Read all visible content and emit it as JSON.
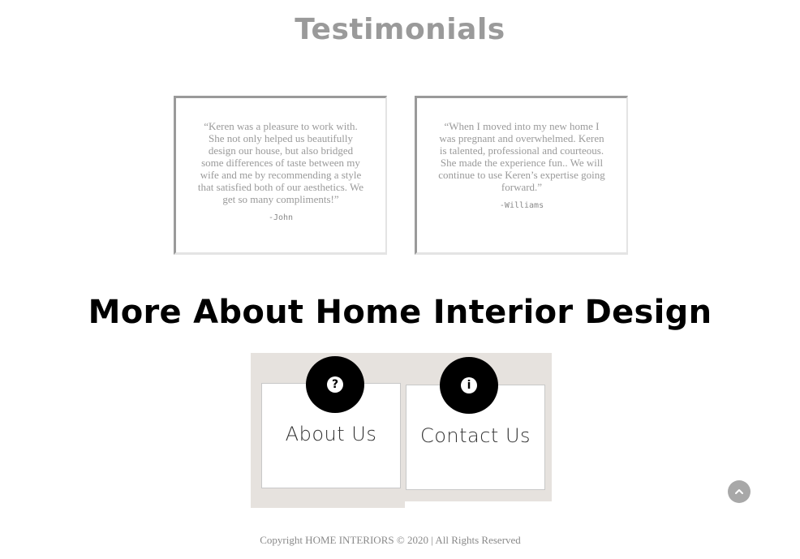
{
  "testimonials": {
    "title": "Testimonials",
    "items": [
      {
        "quote": "“Keren was a pleasure to work with. She not only helped us beautifully design our house, but also bridged some differences of taste between my wife and me by recommending a style that satisfied both of our aesthetics. We get so many compliments!”",
        "author": "-John"
      },
      {
        "quote": "“When I moved into my new home I was pregnant and overwhelmed. Keren is talented, professional and courteous. She made the experience fun.. We will continue to use Keren’s expertise going forward.”",
        "author": "-Williams"
      }
    ]
  },
  "more": {
    "title": "More About Home Interior Design",
    "links": [
      {
        "label": "About Us",
        "icon": "question-circle-icon",
        "glyph": "?"
      },
      {
        "label": "Contact Us",
        "icon": "info-circle-icon",
        "glyph": "i"
      }
    ]
  },
  "scroll_top": {
    "icon": "chevron-up-icon"
  },
  "footer": {
    "copyright": "Copyright HOME INTERIORS © 2020 | All Rights Reserved"
  },
  "colors": {
    "accent_gray": "#9a9a9a",
    "panel_bg": "#e6e2de",
    "icon_bg": "#000000"
  }
}
